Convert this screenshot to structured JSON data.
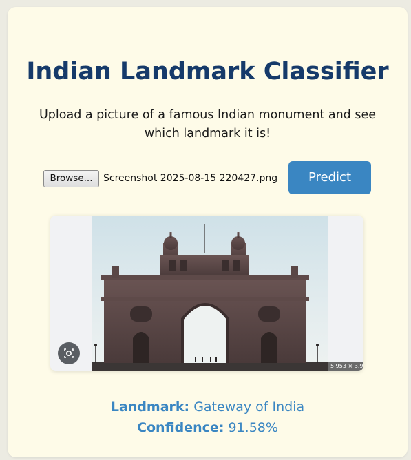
{
  "app": {
    "title": "Indian Landmark Classifier",
    "subtitle": "Upload a picture of a famous Indian monument and see which landmark it is!"
  },
  "upload": {
    "browse_label": "Browse...",
    "filename": "Screenshot 2025-08-15 220427.png",
    "predict_label": "Predict"
  },
  "preview": {
    "dimensions_badge": "5,953 × 3,9",
    "image_subject": "Gateway of India"
  },
  "result": {
    "landmark_label": "Landmark:",
    "landmark_value": "Gateway of India",
    "confidence_label": "Confidence:",
    "confidence_value": "91.58%"
  },
  "colors": {
    "title": "#163a6a",
    "accent": "#3a86c2",
    "card_bg": "#fefbe8",
    "page_bg": "#ecebe2"
  },
  "icons": {
    "lens": "image-search-lens-icon"
  }
}
